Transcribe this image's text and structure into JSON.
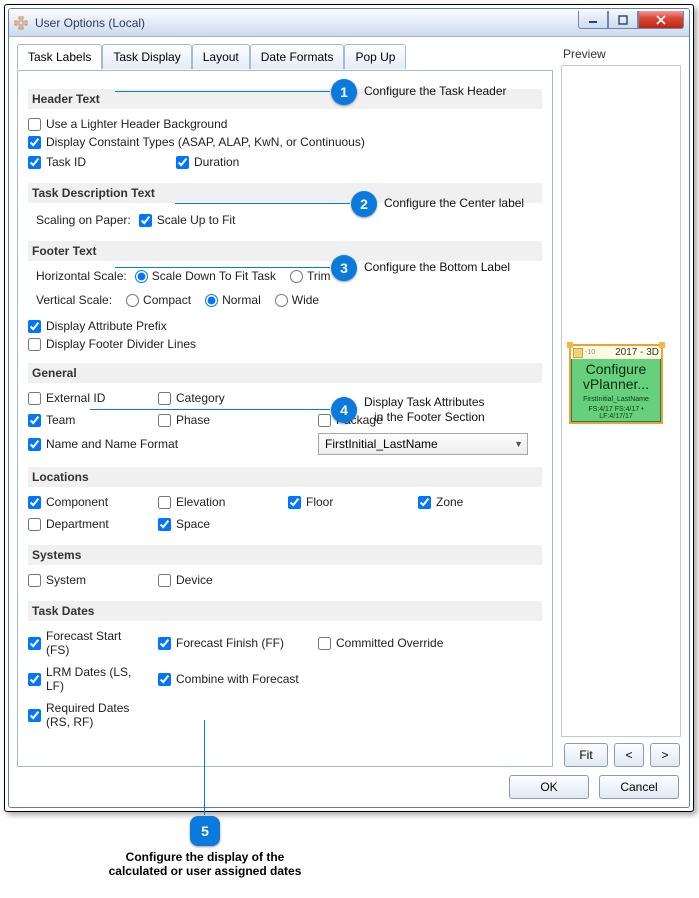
{
  "window": {
    "title": "User Options (Local)"
  },
  "tabs": [
    "Task Labels",
    "Task Display",
    "Layout",
    "Date Formats",
    "Pop Up"
  ],
  "headerText": {
    "section": "Header Text",
    "lighter": "Use a Lighter Header Background",
    "constraint": "Display Constaint Types (ASAP, ALAP, KwN, or Continuous)",
    "taskid": "Task ID",
    "duration": "Duration"
  },
  "taskDesc": {
    "section": "Task Description Text",
    "scalingLabel": "Scaling on Paper:",
    "scaleUp": "Scale Up to Fit"
  },
  "footerText": {
    "section": "Footer Text",
    "hscaleLabel": "Horizontal Scale:",
    "hscale1": "Scale Down To Fit Task",
    "hscale2": "Trim",
    "vscaleLabel": "Vertical Scale:",
    "v1": "Compact",
    "v2": "Normal",
    "v3": "Wide",
    "attrPrefix": "Display Attribute Prefix",
    "dividers": "Display Footer Divider Lines"
  },
  "general": {
    "section": "General",
    "extid": "External ID",
    "category": "Category",
    "team": "Team",
    "phase": "Phase",
    "package": "Package",
    "nameFmt": "Name and Name Format",
    "selectVal": "FirstInitial_LastName"
  },
  "locations": {
    "section": "Locations",
    "component": "Component",
    "elevation": "Elevation",
    "floor": "Floor",
    "zone": "Zone",
    "department": "Department",
    "space": "Space"
  },
  "systems": {
    "section": "Systems",
    "system": "System",
    "device": "Device"
  },
  "taskDates": {
    "section": "Task Dates",
    "fs": "Forecast Start (FS)",
    "ff": "Forecast Finish (FF)",
    "co": "Committed Override",
    "lrm": "LRM Dates (LS, LF)",
    "comb": "Combine with Forecast",
    "req": "Required Dates (RS, RF)"
  },
  "preview": {
    "label": "Preview",
    "hdrText": "2017 - 3D",
    "main": "Configure vPlanner...",
    "foot1": "FirstInitial_LastName",
    "foot2": "FS:4/17 FS:4/17 • LF:4/17/17",
    "fit": "Fit",
    "prev": "<",
    "next": ">"
  },
  "buttons": {
    "ok": "OK",
    "cancel": "Cancel"
  },
  "callouts": {
    "c1": "Configure the Task Header",
    "c2": "Configure the Center label",
    "c3": "Configure the Bottom Label",
    "c4a": "Display Task Attributes",
    "c4b": "in the Footer Section",
    "c5": "Configure the display of the\ncalculated or user assigned dates"
  }
}
